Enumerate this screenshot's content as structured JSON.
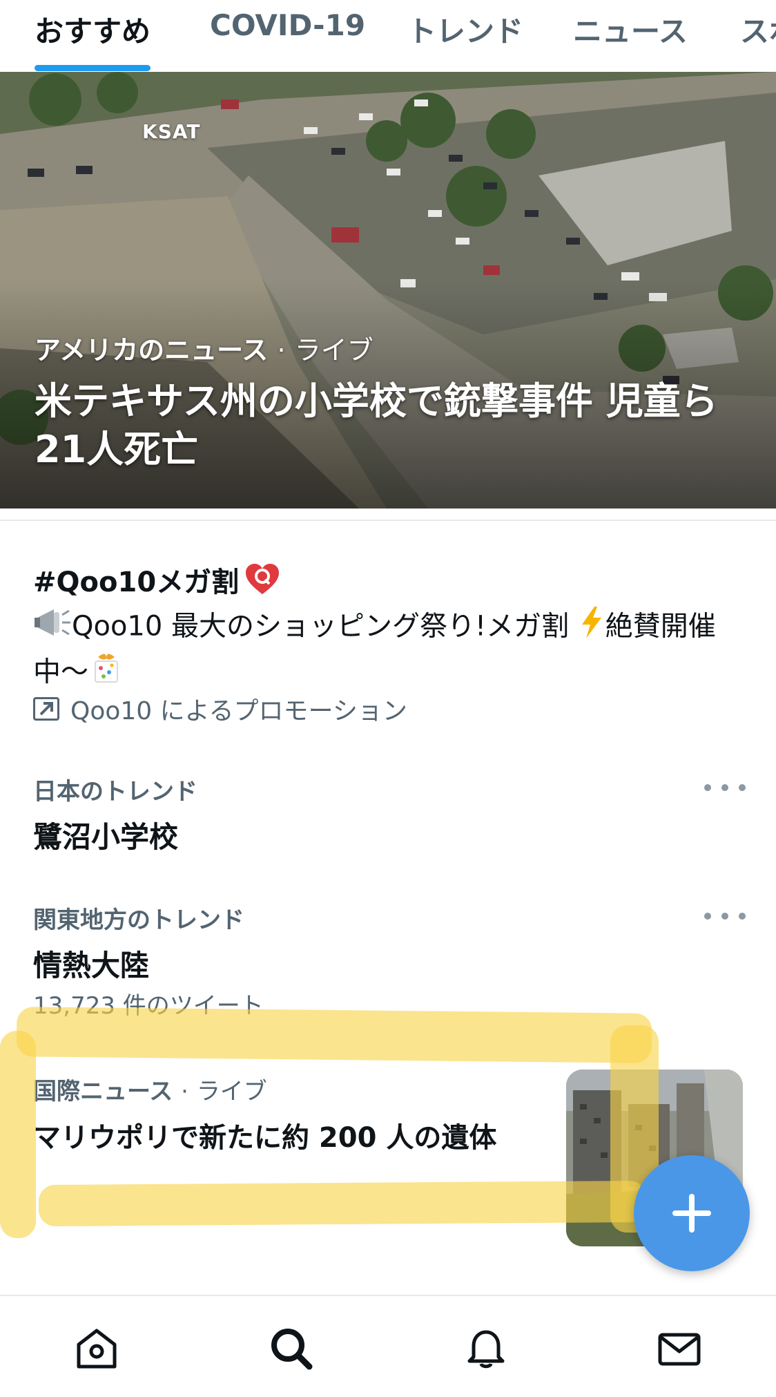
{
  "tabs": [
    {
      "label": "おすすめ",
      "active": true
    },
    {
      "label": "COVID-19",
      "active": false
    },
    {
      "label": "トレンド",
      "active": false
    },
    {
      "label": "ニュース",
      "active": false
    },
    {
      "label": "スポ",
      "active": false
    }
  ],
  "hero": {
    "watermark": "KSAT",
    "category": "アメリカのニュース",
    "separator": "·",
    "status": "ライブ",
    "title": "米テキサス州の小学校で銃撃事件 児童ら 21人死亡"
  },
  "promo": {
    "title": "#Qoo10メガ割",
    "badge_icon": "qoo10-heart-icon",
    "body_part1": "Qoo10 最大のショッピング祭り!メガ割",
    "body_part2": "絶賛開催中〜",
    "icons": [
      "megaphone-icon",
      "lightning-icon",
      "gift-icon"
    ],
    "footer": "Qoo10 によるプロモーション"
  },
  "trends": [
    {
      "category": "日本のトレンド",
      "name": "鷺沼小学校"
    },
    {
      "category": "関東地方のトレンド",
      "name": "情熱大陸",
      "count": "13,723 件のツイート"
    }
  ],
  "news": {
    "category": "国際ニュース",
    "separator": "·",
    "status": "ライブ",
    "title": "マリウポリで新たに約 200 人の遺体"
  },
  "fab": {
    "icon": "plus-icon",
    "color": "#4a97e8"
  },
  "bottom_nav": [
    "home-icon",
    "search-icon",
    "bell-icon",
    "mail-icon"
  ],
  "colors": {
    "accent": "#1d9bf0",
    "text_primary": "#0f1419",
    "text_secondary": "#536471",
    "highlighter": "#f8d448"
  }
}
